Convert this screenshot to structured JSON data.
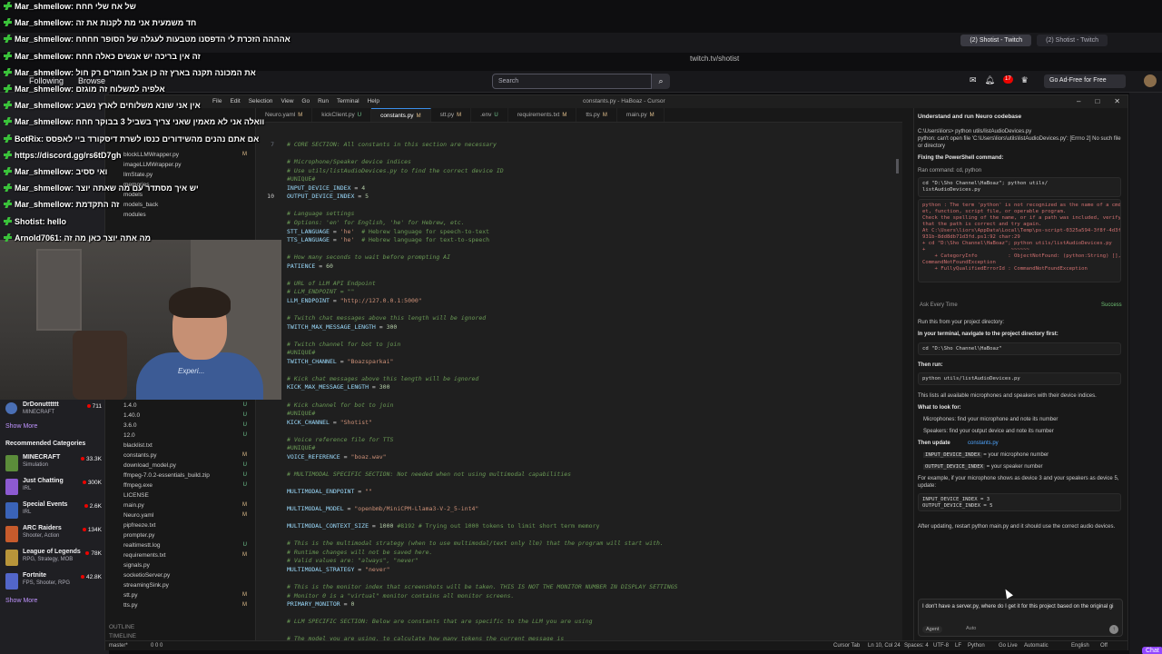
{
  "browser": {
    "tabs": [
      "(2) Shotist - Twitch",
      "(2) Shotist - Twitch"
    ],
    "address": "twitch.tv/shotist"
  },
  "twitch": {
    "following": "Following",
    "browse": "Browse",
    "search_placeholder": "Search",
    "ad_free": "Go Ad-Free for Free",
    "notif_count": "17",
    "followed_channel": {
      "name": "DrDonutttttt",
      "game": "MINECRAFT",
      "viewers": "711"
    },
    "show_more_1": "Show More",
    "recommended_heading": "Recommended Categories",
    "categories": [
      {
        "name": "MINECRAFT",
        "tags": "Simulation",
        "viewers": "33.3K",
        "color": "#5b8c3a"
      },
      {
        "name": "Just Chatting",
        "tags": "IRL",
        "viewers": "300K",
        "color": "#8d5ad1"
      },
      {
        "name": "Special Events",
        "tags": "IRL",
        "viewers": "2.6K",
        "color": "#3a63b8"
      },
      {
        "name": "ARC Raiders",
        "tags": "Shooter, Action",
        "viewers": "134K",
        "color": "#c75b2c"
      },
      {
        "name": "League of Legends",
        "tags": "RPG, Strategy, MOB",
        "viewers": "78K",
        "color": "#b8953a"
      },
      {
        "name": "Fortnite",
        "tags": "FPS, Shooter, RPG",
        "viewers": "42.8K",
        "color": "#5266c9"
      }
    ],
    "show_more_2": "Show More",
    "chat_button": "Chat"
  },
  "chat_overlay": [
    {
      "user": "Mar_shmellow",
      "msg": "של אח שלי חחח"
    },
    {
      "user": "Mar_shmellow",
      "msg": "חד משמעית אני מת לקנות את זה"
    },
    {
      "user": "Mar_shmellow",
      "msg": "אהההה הזכרת לי הדפסנו מטבעות לעגלה של הסופר חחחח"
    },
    {
      "user": "Mar_shmellow",
      "msg": "זה אין בריכה יש אנשים כאלה חחח"
    },
    {
      "user": "Mar_shmellow",
      "msg": "את המכונה תקנה בארץ זה כן אבל חומרים רק חול"
    },
    {
      "user": "Mar_shmellow",
      "msg": "אלפיה למשלוח זה מוגזם"
    },
    {
      "user": "Mar_shmellow",
      "msg": "אין אני שונא משלוחים לארץ נשבע"
    },
    {
      "user": "Mar_shmellow",
      "msg": "וואלה אני לא מאמין שאני צריך בשביל 3 בבוקר חחח"
    },
    {
      "user": "BotRix",
      "msg": "אם אתם נהנים מהשידורים כנסו לשרת דיסקורד ביי לאפסס"
    },
    {
      "user": "",
      "msg": "https://discord.gg/rs6tD7gh"
    },
    {
      "user": "Mar_shmellow",
      "msg": "ואי ססיב"
    },
    {
      "user": "Mar_shmellow",
      "msg": "יש איך מסתדר עם מה שאתה יוצר"
    },
    {
      "user": "Mar_shmellow",
      "msg": "זה התקדמת"
    },
    {
      "user": "Shotist",
      "msg": "hello"
    },
    {
      "user": "Arnold7061",
      "msg": "מה אתה יוצר כאן מה זה"
    }
  ],
  "webcam": {
    "shirt_text": "Experi..."
  },
  "ide": {
    "menu": [
      "File",
      "Edit",
      "Selection",
      "View",
      "Go",
      "Run",
      "Terminal",
      "Help"
    ],
    "window_title": "constants.py - HaBoaz - Cursor",
    "tabs": [
      {
        "name": "Neuro.yaml",
        "status": "M"
      },
      {
        "name": "kickClient.py",
        "status": "U"
      },
      {
        "name": "constants.py",
        "status": "M"
      },
      {
        "name": "stt.py",
        "status": "M"
      },
      {
        "name": ".env",
        "status": "U"
      },
      {
        "name": "requirements.txt",
        "status": "M"
      },
      {
        "name": "tts.py",
        "status": "M"
      },
      {
        "name": "main.py",
        "status": "M"
      }
    ],
    "explorer_top": [
      {
        "name": "blockLLMWrapper.py",
        "status": "M"
      },
      {
        "name": "imageLLMWrapper.py",
        "status": ""
      },
      {
        "name": "llmState.py",
        "status": ""
      },
      {
        "name": "memories",
        "status": ""
      },
      {
        "name": "models",
        "status": ""
      },
      {
        "name": "models_back",
        "status": ""
      },
      {
        "name": "modules",
        "status": ""
      }
    ],
    "explorer_bottom": [
      {
        "name": "1.4.0",
        "status": "U"
      },
      {
        "name": "1.40.0",
        "status": "U"
      },
      {
        "name": "3.6.0",
        "status": "U"
      },
      {
        "name": "12.0",
        "status": "U"
      },
      {
        "name": "blacklist.txt",
        "status": ""
      },
      {
        "name": "constants.py",
        "status": "M"
      },
      {
        "name": "download_model.py",
        "status": "U"
      },
      {
        "name": "ffmpeg-7.0.2-essentials_build.zip",
        "status": "U"
      },
      {
        "name": "ffmpeg.exe",
        "status": "U"
      },
      {
        "name": "LICENSE",
        "status": ""
      },
      {
        "name": "main.py",
        "status": "M"
      },
      {
        "name": "Neuro.yaml",
        "status": "M"
      },
      {
        "name": "pipfreeze.txt",
        "status": ""
      },
      {
        "name": "prompter.py",
        "status": ""
      },
      {
        "name": "realtimestt.log",
        "status": "U"
      },
      {
        "name": "requirements.txt",
        "status": "M"
      },
      {
        "name": "signals.py",
        "status": ""
      },
      {
        "name": "socketioServer.py",
        "status": ""
      },
      {
        "name": "streamingSink.py",
        "status": ""
      },
      {
        "name": "stt.py",
        "status": "M"
      },
      {
        "name": "tts.py",
        "status": "M"
      }
    ],
    "outline_label": "OUTLINE",
    "timeline_label": "TIMELINE",
    "code": [
      {
        "n": "7",
        "t": "comment",
        "text": "# CORE SECTION: All constants in this section are necessary"
      },
      {
        "n": "",
        "t": "blank",
        "text": ""
      },
      {
        "n": "",
        "t": "comment",
        "text": "# Microphone/Speaker device indices"
      },
      {
        "n": "",
        "t": "comment",
        "text": "# Use utils/listAudioDevices.py to find the correct device ID"
      },
      {
        "n": "",
        "t": "tag",
        "text": "#UNIQUE#"
      },
      {
        "n": "",
        "t": "assign",
        "var": "INPUT_DEVICE_INDEX",
        "val": "4",
        "vt": "num"
      },
      {
        "n": "10",
        "t": "assign",
        "var": "OUTPUT_DEVICE_INDEX",
        "val": "5",
        "vt": "num",
        "cur": true
      },
      {
        "n": "",
        "t": "blank",
        "text": ""
      },
      {
        "n": "",
        "t": "comment",
        "text": "# Language settings"
      },
      {
        "n": "",
        "t": "comment",
        "text": "# Options: 'en' for English, 'he' for Hebrew, etc."
      },
      {
        "n": "",
        "t": "assign",
        "var": "STT_LANGUAGE",
        "val": "'he'",
        "vt": "str",
        "tail": "  # Hebrew language for speech-to-text"
      },
      {
        "n": "",
        "t": "assign",
        "var": "TTS_LANGUAGE",
        "val": "'he'",
        "vt": "str",
        "tail": "  # Hebrew language for text-to-speech"
      },
      {
        "n": "",
        "t": "blank",
        "text": ""
      },
      {
        "n": "",
        "t": "comment",
        "text": "# How many seconds to wait before prompting AI"
      },
      {
        "n": "",
        "t": "assign",
        "var": "PATIENCE",
        "val": "60",
        "vt": "num"
      },
      {
        "n": "",
        "t": "blank",
        "text": ""
      },
      {
        "n": "",
        "t": "comment",
        "text": "# URL of LLM API Endpoint"
      },
      {
        "n": "",
        "t": "comment",
        "text": "# LLM_ENDPOINT = \"\""
      },
      {
        "n": "",
        "t": "assign",
        "var": "LLM_ENDPOINT",
        "val": "\"http://127.0.0.1:5000\"",
        "vt": "str"
      },
      {
        "n": "",
        "t": "blank",
        "text": ""
      },
      {
        "n": "",
        "t": "comment",
        "text": "# Twitch chat messages above this length will be ignored"
      },
      {
        "n": "",
        "t": "assign",
        "var": "TWITCH_MAX_MESSAGE_LENGTH",
        "val": "300",
        "vt": "num"
      },
      {
        "n": "",
        "t": "blank",
        "text": ""
      },
      {
        "n": "",
        "t": "comment",
        "text": "# Twitch channel for bot to join"
      },
      {
        "n": "",
        "t": "tag",
        "text": "#UNIQUE#"
      },
      {
        "n": "",
        "t": "assign",
        "var": "TWITCH_CHANNEL",
        "val": "\"Boazsparkai\"",
        "vt": "str"
      },
      {
        "n": "",
        "t": "blank",
        "text": ""
      },
      {
        "n": "",
        "t": "comment",
        "text": "# Kick chat messages above this length will be ignored"
      },
      {
        "n": "",
        "t": "assign",
        "var": "KICK_MAX_MESSAGE_LENGTH",
        "val": "300",
        "vt": "num"
      },
      {
        "n": "",
        "t": "blank",
        "text": ""
      },
      {
        "n": "",
        "t": "comment",
        "text": "# Kick channel for bot to join"
      },
      {
        "n": "",
        "t": "tag",
        "text": "#UNIQUE#"
      },
      {
        "n": "",
        "t": "assign",
        "var": "KICK_CHANNEL",
        "val": "\"Shotist\"",
        "vt": "str"
      },
      {
        "n": "",
        "t": "blank",
        "text": ""
      },
      {
        "n": "",
        "t": "comment",
        "text": "# Voice reference file for TTS"
      },
      {
        "n": "",
        "t": "tag",
        "text": "#UNIQUE#"
      },
      {
        "n": "",
        "t": "assign",
        "var": "VOICE_REFERENCE",
        "val": "\"boaz.wav\"",
        "vt": "str"
      },
      {
        "n": "",
        "t": "blank",
        "text": ""
      },
      {
        "n": "",
        "t": "comment",
        "text": "# MULTIMODAL SPECIFIC SECTION: Not needed when not using multimodal capabilities"
      },
      {
        "n": "",
        "t": "blank",
        "text": ""
      },
      {
        "n": "",
        "t": "assign",
        "var": "MULTIMODAL_ENDPOINT",
        "val": "\"\"",
        "vt": "str"
      },
      {
        "n": "",
        "t": "blank",
        "text": ""
      },
      {
        "n": "",
        "t": "assign",
        "var": "MULTIMODAL_MODEL",
        "val": "\"openbmb/MiniCPM-Llama3-V-2_5-int4\"",
        "vt": "str"
      },
      {
        "n": "",
        "t": "blank",
        "text": ""
      },
      {
        "n": "",
        "t": "assign",
        "var": "MULTIMODAL_CONTEXT_SIZE",
        "val": "1000",
        "vt": "num",
        "tail": " #8192 # Trying out 1000 tokens to limit short term memory"
      },
      {
        "n": "",
        "t": "blank",
        "text": ""
      },
      {
        "n": "",
        "t": "comment",
        "text": "# This is the multimodal strategy (when to use multimodal/text only llm) that the program will start with."
      },
      {
        "n": "",
        "t": "comment",
        "text": "# Runtime changes will not be saved here."
      },
      {
        "n": "",
        "t": "comment",
        "text": "# Valid values are: \"always\", \"never\""
      },
      {
        "n": "",
        "t": "assign",
        "var": "MULTIMODAL_STRATEGY",
        "val": "\"never\"",
        "vt": "str"
      },
      {
        "n": "",
        "t": "blank",
        "text": ""
      },
      {
        "n": "",
        "t": "comment",
        "text": "# This is the monitor index that screenshots will be taken. THIS IS NOT THE MONITOR NUMBER IN DISPLAY SETTINGS"
      },
      {
        "n": "",
        "t": "comment",
        "text": "# Monitor 0 is a \"virtual\" monitor contains all monitor screens."
      },
      {
        "n": "",
        "t": "assign",
        "var": "PRIMARY_MONITOR",
        "val": "0",
        "vt": "num"
      },
      {
        "n": "",
        "t": "blank",
        "text": ""
      },
      {
        "n": "",
        "t": "comment",
        "text": "# LLM SPECIFIC SECTION: Below are constants that are specific to the LLM you are using"
      },
      {
        "n": "",
        "t": "blank",
        "text": ""
      },
      {
        "n": "",
        "t": "comment",
        "text": "# The model you are using, to calculate how many tokens the current message is"
      }
    ],
    "agent": {
      "title": "Understand and run Neuro codebase",
      "prompt_path": "C:\\Users\\liors>   python utils/listAudioDevices.py",
      "error_line": "python: can't open file 'C:\\Users\\liors\\utils\\listAudioDevices.py': [Errno 2] No such file or directory",
      "fixing": "Fixing the PowerShell command:",
      "ran_command": "Ran command: cd, python",
      "cmd": "cd \"D:\\Sho Channel\\HaBoaz\"; python utils/\nlistAudioDevices.py",
      "cmd_output": "python : The term 'python' is not recognized as the name of a cmdl\net, function, script file, or operable program.\nCheck the spelling of the name, or if a path was included, verify\nthat the path is correct and try again.\nAt C:\\Users\\liors\\AppData\\Local\\Temp\\ps-script-0325a594-3f8f-4d3f-\n931b-8dd8db71d3fd.ps1:92 char:29\n+ cd \"D:\\Sho Channel\\HaBoaz\"; python utils/listAudioDevices.py\n+                            ~~~~~~\n    + CategoryInfo          : ObjectNotFound: (python:String) [],\nCommandNotFoundException\n    + FullyQualifiedErrorId : CommandNotFoundException",
      "ask_every_time": "Ask Every Time",
      "success": "Success",
      "run_from": "Run this from your project directory:",
      "navigate": "In your terminal, navigate to the project directory first:",
      "cd_cmd": "cd \"D:\\Sho Channel\\HaBoaz\"",
      "then_run": "Then run:",
      "run_cmd": "python utils/listAudioDevices.py",
      "lists": "This lists all available microphones and speakers with their device indices.",
      "what_to_look": "What to look for:",
      "bullet_mic": "Microphones: find your microphone and note its number",
      "bullet_spk": "Speakers: find your output device and note its number",
      "then_update": "Then update",
      "then_update_file": "constants.py",
      "bullet_in": "INPUT_DEVICE_INDEX",
      "bullet_in_tail": " = your microphone number",
      "bullet_out": "OUTPUT_DEVICE_INDEX",
      "bullet_out_tail": " = your speaker number",
      "example": "For example, if your microphone shows as device 3 and your speakers as device 5, update:",
      "example_code": "INPUT_DEVICE_INDEX = 3\nOUTPUT_DEVICE_INDEX = 5",
      "after": "After updating, restart python main.py and it should use the correct audio devices.",
      "input_text": "I don't have a server.py, where do I get it for this project based on the original gi",
      "agent_label": "Agent",
      "auto_label": "Auto"
    },
    "status": {
      "branch": "master*",
      "problems": "0  0  0",
      "cursor_tab": "Cursor Tab",
      "position": "Ln 10, Col 24",
      "spaces": "Spaces: 4",
      "encoding": "UTF-8",
      "eol": "LF",
      "language": "Python",
      "golive": "Go Live",
      "mode": "Automatic",
      "lang": "English",
      "off": "Off"
    }
  }
}
